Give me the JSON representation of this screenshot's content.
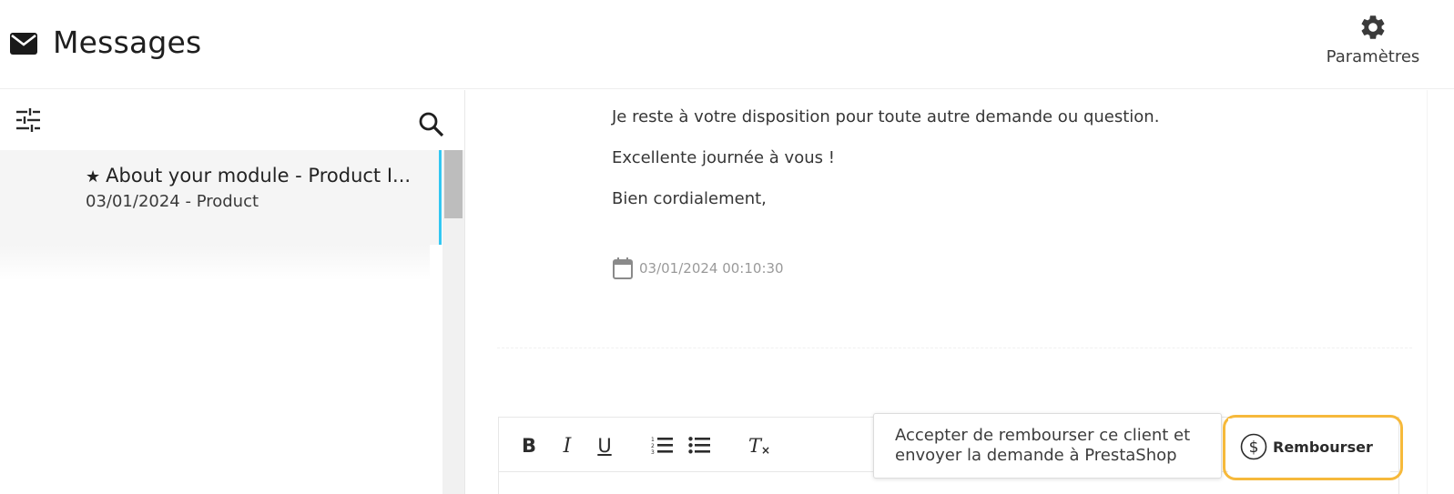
{
  "header": {
    "icon": "mail-icon",
    "title": "Messages",
    "settings_icon": "gear-icon",
    "settings_label": "Paramètres"
  },
  "sidebar": {
    "filter_icon": "sliders-icon",
    "search_icon": "search-icon",
    "conversations": [
      {
        "starred": true,
        "star_glyph": "★",
        "title": "About your module - Product I...",
        "date": "03/01/2024",
        "separator": " - ",
        "category": "Product"
      }
    ]
  },
  "message": {
    "lines": [
      "Je reste à votre disposition pour toute autre demande ou question.",
      "Excellente journée à vous !",
      "Bien cordialement,"
    ],
    "date_icon": "calendar-icon",
    "timestamp": "03/01/2024 00:10:30"
  },
  "editor": {
    "toolbar": {
      "bold": "B",
      "italic": "I",
      "underline": "U",
      "ordered_list_icon": "ordered-list-icon",
      "bullet_list_icon": "bullet-list-icon",
      "clear_format": "T"
    }
  },
  "refund": {
    "tooltip": "Accepter de rembourser ce client et envoyer la demande à PrestaShop",
    "button_icon": "dollar-circle-icon",
    "button_label": "Rembourser",
    "highlight_color": "#f6b93b"
  },
  "colors": {
    "accent": "#33c7f2",
    "selected_bg": "#f5f5f5",
    "muted_text": "#9a9a9a"
  }
}
